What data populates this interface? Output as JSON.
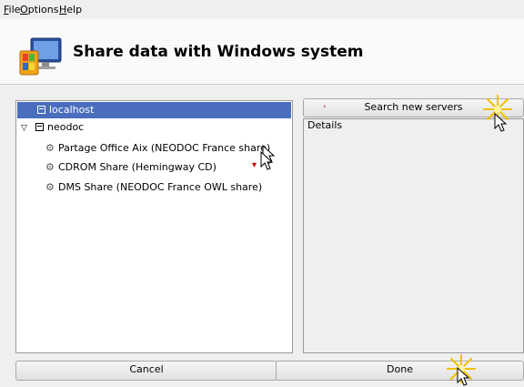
{
  "menubar": {
    "file": "File",
    "options": "Options",
    "help": "Help"
  },
  "header": {
    "title": "Share data with Windows system",
    "icon": "computer-network-icon"
  },
  "tree": {
    "items": [
      {
        "label": "localhost",
        "icon": "host-icon",
        "selected": true
      },
      {
        "label": "neodoc",
        "icon": "host-icon",
        "expanded": true
      },
      {
        "label": "Partage Office Aix (NEODOC France share)",
        "icon": "share-icon"
      },
      {
        "label": "CDROM Share (Hemingway CD)",
        "icon": "share-icon"
      },
      {
        "label": "DMS Share (NEODOC France OWL share)",
        "icon": "share-icon"
      }
    ]
  },
  "details": {
    "search_button": "Search new servers",
    "label": "Details"
  },
  "footer": {
    "cancel": "Cancel",
    "done": "Done"
  },
  "colors": {
    "selection": "#4a6ebd",
    "window_bg": "#efefef",
    "accent_mark": "#d00000"
  }
}
